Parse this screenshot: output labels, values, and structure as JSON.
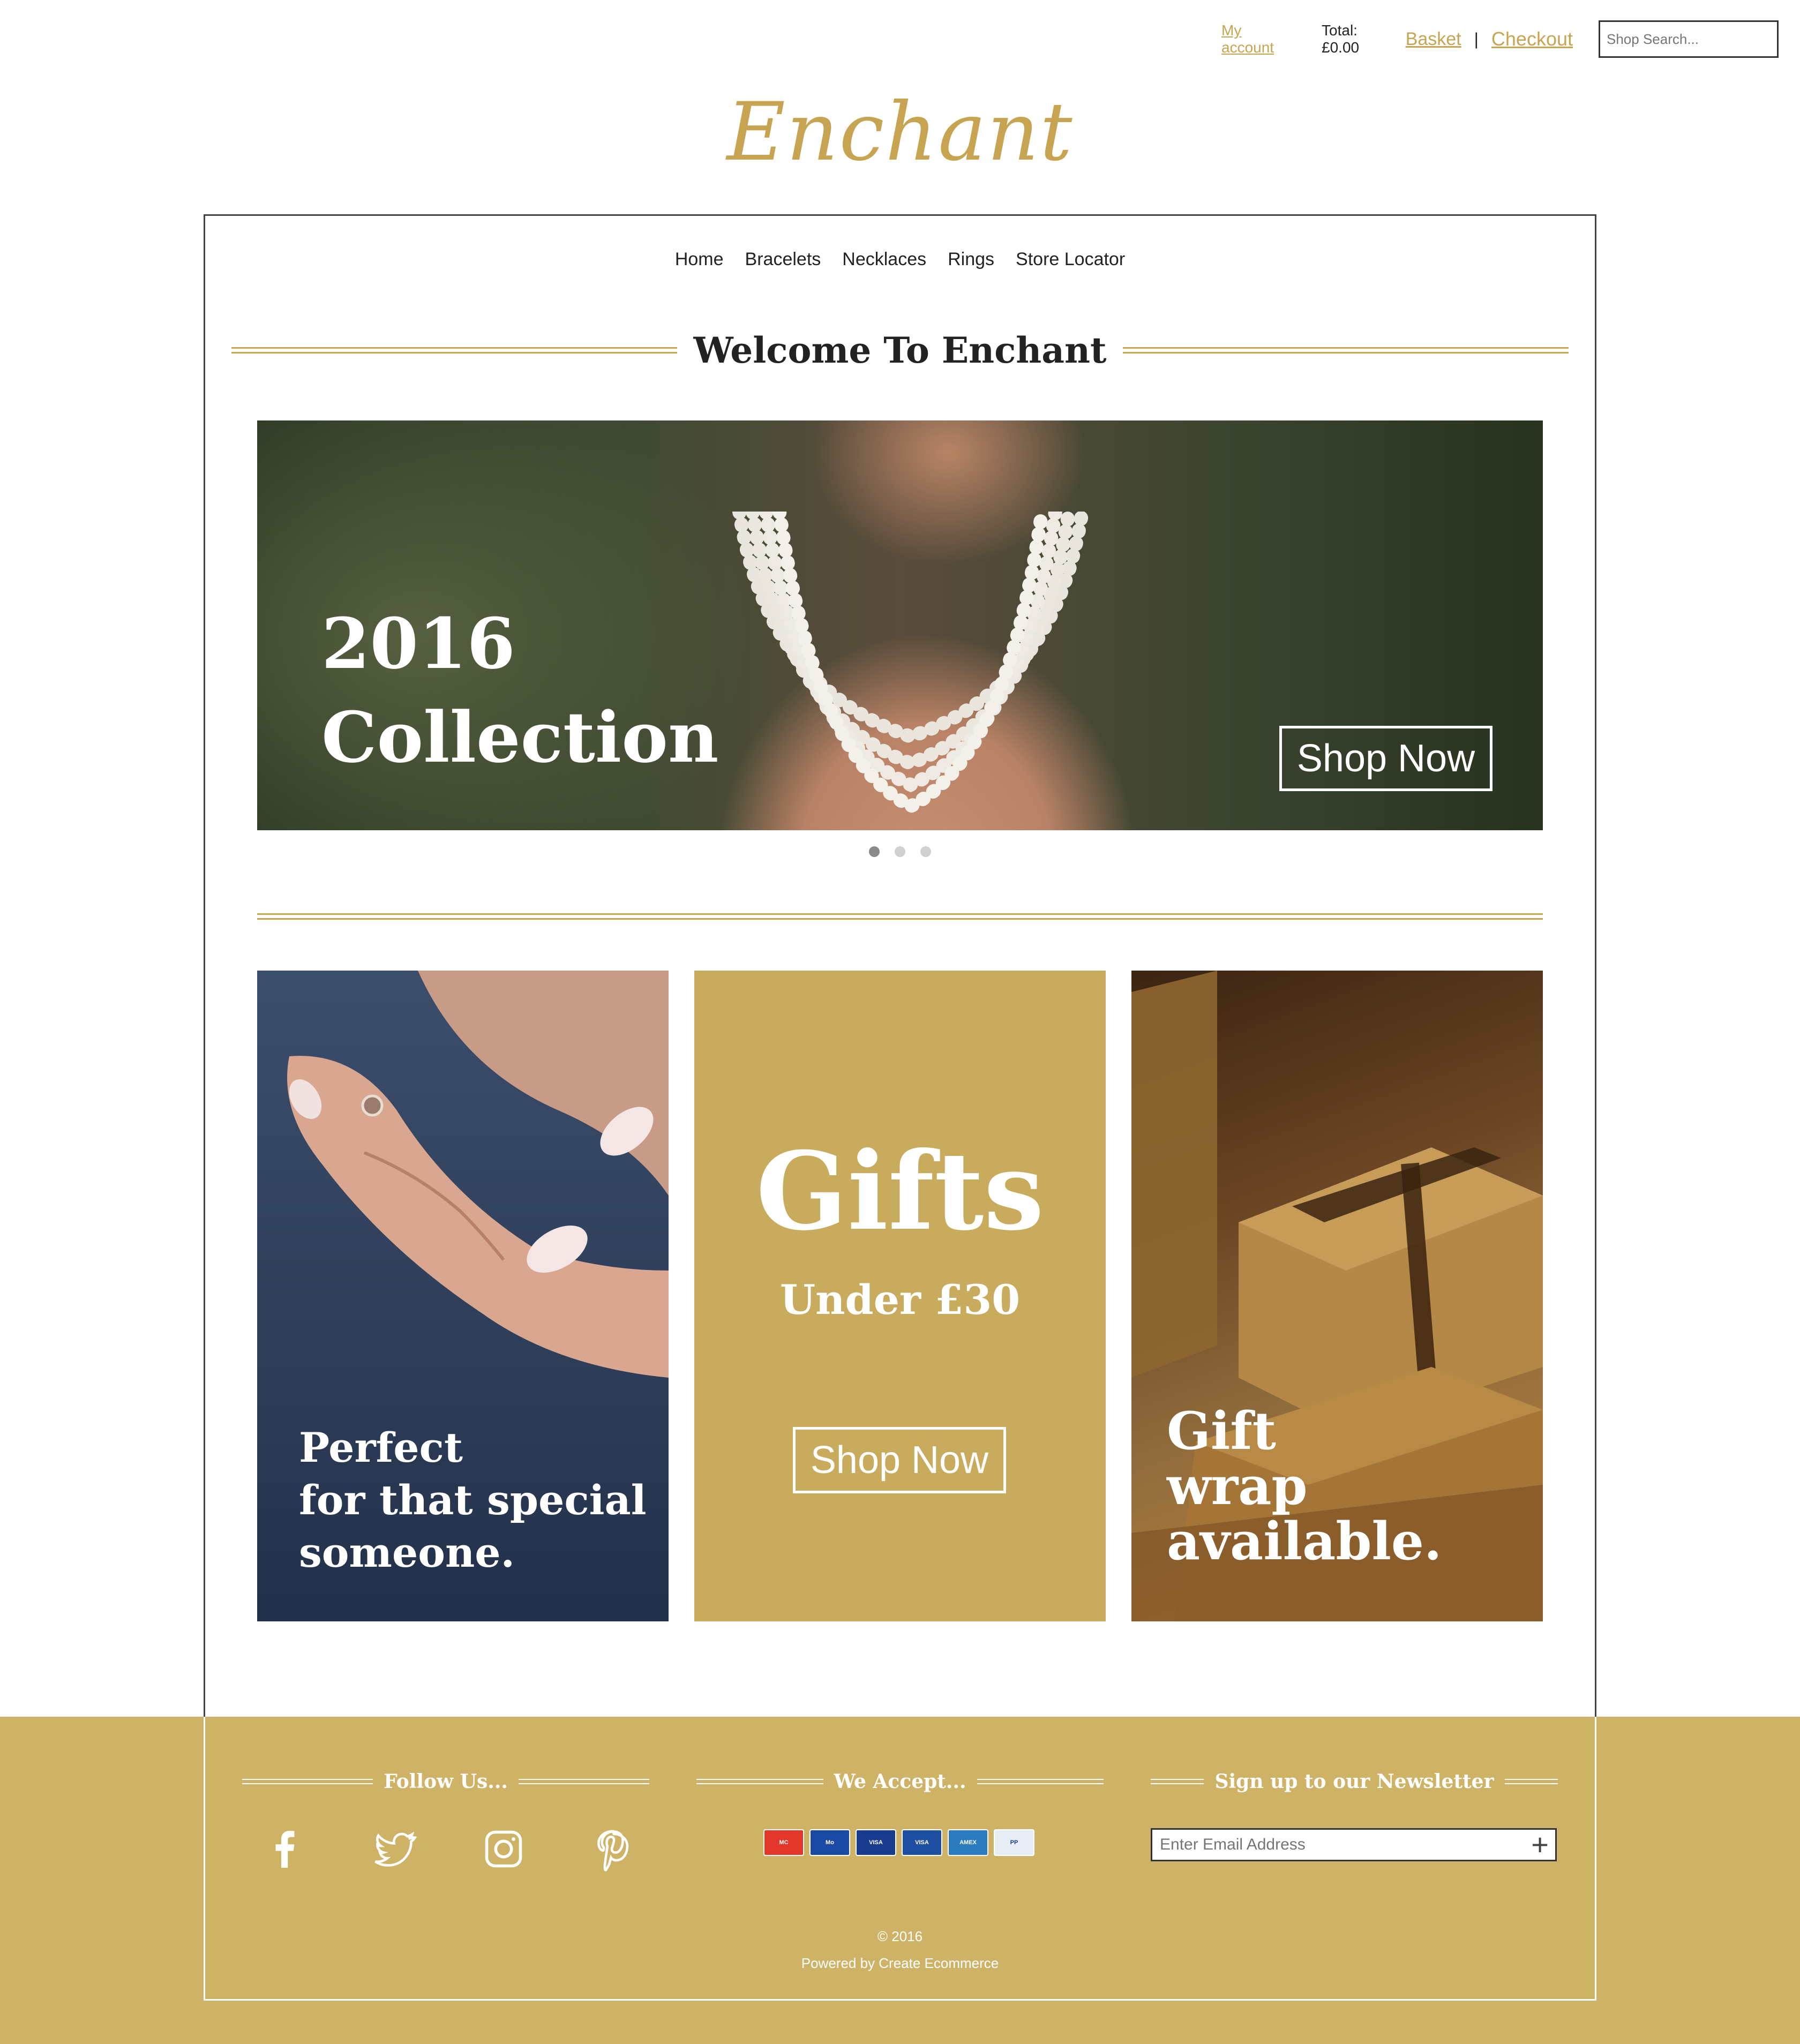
{
  "topbar": {
    "my_account": "My account",
    "total": "Total: £0.00",
    "basket": "Basket",
    "separator": "|",
    "checkout": "Checkout",
    "search_placeholder": "Shop Search..."
  },
  "logo": "Enchant",
  "nav": [
    "Home",
    "Bracelets",
    "Necklaces",
    "Rings",
    "Store Locator"
  ],
  "welcome": "Welcome To Enchant",
  "hero": {
    "line1": "2016",
    "line2": "Collection",
    "cta": "Shop Now",
    "slides": 3,
    "active_slide": 1
  },
  "tiles": {
    "ring": {
      "line1": "Perfect",
      "line2": "for that special",
      "line3": "someone."
    },
    "gifts": {
      "title": "Gifts",
      "subtitle": "Under £30",
      "cta": "Shop Now"
    },
    "wrap": {
      "line1": "Gift",
      "line2": "wrap",
      "line3": "available."
    }
  },
  "footer": {
    "follow": "Follow Us...",
    "accept": "We Accept...",
    "newsletter": "Sign up to our Newsletter",
    "email_placeholder": "Enter Email Address",
    "social": [
      "facebook-icon",
      "twitter-icon",
      "instagram-icon",
      "pinterest-icon"
    ],
    "cards": [
      {
        "name": "MasterCard",
        "color": "#e3372b"
      },
      {
        "name": "Maestro",
        "color": "#1a4aa3"
      },
      {
        "name": "VISA",
        "color": "#1a3c8f"
      },
      {
        "name": "VISA Electron",
        "color": "#1f4fa0"
      },
      {
        "name": "AMEX",
        "color": "#2d7bbf"
      },
      {
        "name": "PayPal",
        "color": "#e8eef5"
      }
    ],
    "copyright": "© 2016",
    "powered": "Powered by Create Ecommerce"
  },
  "colors": {
    "gold": "#c7a452",
    "footer": "#ceb266"
  }
}
